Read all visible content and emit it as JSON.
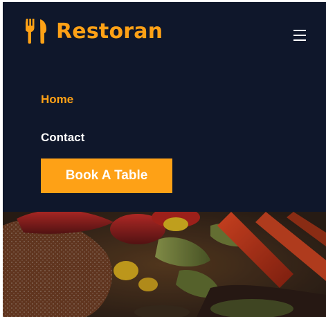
{
  "brand": {
    "name": "Restoran",
    "icon": "utensils-icon",
    "color": "#fea116"
  },
  "nav": {
    "toggle_icon": "hamburger-menu-icon",
    "items": [
      {
        "label": "Home",
        "active": true
      },
      {
        "label": "Contact",
        "active": false
      }
    ],
    "cta": {
      "label": "Book A Table"
    }
  },
  "colors": {
    "background": "#0f172b",
    "accent": "#fea116",
    "text": "#ffffff"
  },
  "hero": {
    "image": "food-hero-image"
  }
}
